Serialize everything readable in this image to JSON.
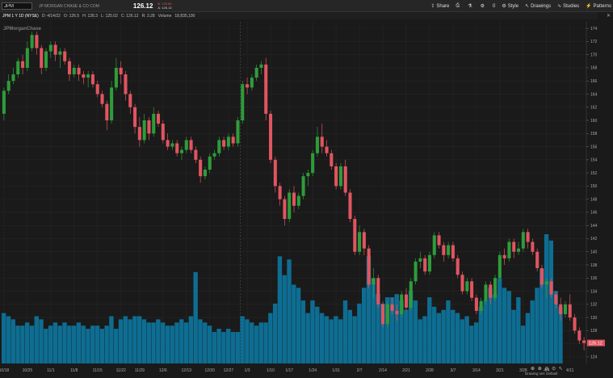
{
  "toolbar": {
    "symbol": "JPM",
    "company": "JP MORGAN CHASE & CO COM",
    "price": "126.12",
    "bid": "B: 125.80",
    "ask": "A: 126.13",
    "share": "Share",
    "count": "0",
    "style": "Style",
    "drawings": "Drawings",
    "studies": "Studies",
    "patterns": "Patterns"
  },
  "info": {
    "series": "JPM 1 Y 1D (NYSE)",
    "date": "D: 4/14/22",
    "open": "O: 126.5",
    "high": "H: 128.3",
    "low": "L: 125.02",
    "close": "C: 126.12",
    "change": "R: 3.28",
    "volume_label": "Volume",
    "volume_value": "18,835,190"
  },
  "watermark": "JPMorganChase",
  "footer": "Drawing set: Default",
  "colors": {
    "up": "#2e9c3a",
    "down": "#e05560",
    "volume": "#0e6d92",
    "background": "#1a1a1a",
    "last_price_tag": "#e05560"
  },
  "chart_data": {
    "type": "candlestick",
    "x_tick_labels": [
      "10/18",
      "10/25",
      "11/1",
      "11/8",
      "11/15",
      "11/22",
      "11/29",
      "12/6",
      "12/13",
      "12/20",
      "12/27",
      "1/3",
      "1/10",
      "1/17",
      "1/24",
      "1/31",
      "2/7",
      "2/14",
      "2/21",
      "2/28",
      "3/7",
      "3/14",
      "3/21",
      "3/28",
      "4/4",
      "4/11"
    ],
    "x_tick_index": [
      0,
      5,
      10,
      15,
      20,
      25,
      29,
      34,
      39,
      44,
      48,
      52,
      57,
      61,
      66,
      71,
      76,
      81,
      86,
      91,
      96,
      101,
      106,
      111,
      116,
      121
    ],
    "y_ticks": [
      124,
      126,
      128,
      130,
      132,
      134,
      136,
      138,
      140,
      142,
      144,
      146,
      148,
      150,
      152,
      154,
      156,
      158,
      160,
      162,
      164,
      166,
      168,
      170,
      172,
      174
    ],
    "ylim": [
      123,
      175
    ],
    "last_price": "126.12",
    "candles": [
      [
        161,
        165,
        160,
        164.5
      ],
      [
        164.5,
        167,
        164,
        166
      ],
      [
        166,
        168,
        165.5,
        167
      ],
      [
        167,
        169.5,
        166.5,
        169
      ],
      [
        169,
        170,
        167,
        168
      ],
      [
        168,
        172,
        167.5,
        171
      ],
      [
        171,
        173.5,
        170.5,
        173
      ],
      [
        173,
        173.5,
        170,
        171
      ],
      [
        171,
        171.5,
        167,
        168
      ],
      [
        168,
        171,
        167.5,
        170.5
      ],
      [
        170.5,
        172,
        169.5,
        171.5
      ],
      [
        171.5,
        172,
        169,
        170
      ],
      [
        170,
        171,
        168,
        170.5
      ],
      [
        170.5,
        171,
        168.5,
        169
      ],
      [
        169,
        169.5,
        166,
        167
      ],
      [
        167,
        168.5,
        166.5,
        168
      ],
      [
        168,
        168.5,
        166,
        167
      ],
      [
        167,
        167.5,
        165.5,
        166.5
      ],
      [
        166.5,
        167.5,
        165,
        167
      ],
      [
        167,
        167.5,
        165,
        165.5
      ],
      [
        165.5,
        166,
        163.5,
        164
      ],
      [
        164,
        164.5,
        162,
        162.5
      ],
      [
        162.5,
        163,
        158.5,
        160
      ],
      [
        160,
        166,
        159.5,
        165
      ],
      [
        165,
        169.5,
        164.5,
        168
      ],
      [
        168,
        169,
        165.5,
        167
      ],
      [
        167,
        167.5,
        163,
        164
      ],
      [
        164,
        164.5,
        161,
        162
      ],
      [
        162,
        162.5,
        158,
        159
      ],
      [
        159,
        160.5,
        156,
        157
      ],
      [
        157,
        161,
        156.5,
        160
      ],
      [
        160,
        160.5,
        157,
        158
      ],
      [
        158,
        162,
        157.5,
        161
      ],
      [
        161,
        161.5,
        159,
        159.5
      ],
      [
        159.5,
        160,
        156.5,
        157
      ],
      [
        157,
        158,
        155.5,
        156
      ],
      [
        156,
        157,
        155.5,
        156.5
      ],
      [
        156.5,
        157,
        154.5,
        155
      ],
      [
        155,
        156,
        154,
        155.5
      ],
      [
        155.5,
        157.5,
        155,
        157
      ],
      [
        157,
        157.5,
        155,
        155.5
      ],
      [
        155.5,
        156,
        153.5,
        154
      ],
      [
        154,
        154.5,
        150.5,
        151.5
      ],
      [
        151.5,
        153,
        151,
        152.5
      ],
      [
        152.5,
        155,
        152,
        154.5
      ],
      [
        154.5,
        155.5,
        154,
        155
      ],
      [
        155,
        157.5,
        154.5,
        157
      ],
      [
        157,
        157.5,
        155.5,
        156
      ],
      [
        156,
        158,
        155.5,
        157.5
      ],
      [
        157.5,
        158,
        156,
        156.5
      ],
      [
        156.5,
        160.5,
        156,
        160
      ],
      [
        160,
        166,
        159.5,
        165.5
      ],
      [
        165.5,
        166.5,
        164,
        165
      ],
      [
        165,
        167,
        164.5,
        166.5
      ],
      [
        166.5,
        168.5,
        166,
        168
      ],
      [
        168,
        169,
        167,
        168.5
      ],
      [
        168.5,
        169.5,
        160,
        161
      ],
      [
        161,
        161.5,
        153.5,
        154
      ],
      [
        154,
        154.5,
        149,
        150
      ],
      [
        150,
        150.5,
        147,
        148
      ],
      [
        148,
        148.5,
        144,
        145
      ],
      [
        145,
        149.5,
        144.5,
        149
      ],
      [
        149,
        150,
        146,
        147
      ],
      [
        147,
        149,
        146.5,
        148.5
      ],
      [
        148.5,
        152,
        148,
        151.5
      ],
      [
        151.5,
        152.5,
        150,
        152
      ],
      [
        152,
        155.5,
        151.5,
        155
      ],
      [
        155,
        159,
        154.5,
        157.5
      ],
      [
        157.5,
        159.5,
        155,
        156
      ],
      [
        156,
        157,
        154.5,
        155
      ],
      [
        155,
        155.5,
        152.5,
        153
      ],
      [
        153,
        153.5,
        149.5,
        150
      ],
      [
        150,
        153.5,
        149.5,
        153
      ],
      [
        153,
        154,
        148.5,
        149
      ],
      [
        149,
        149.5,
        144.5,
        145
      ],
      [
        145,
        145.5,
        139.5,
        140
      ],
      [
        140,
        144,
        139.5,
        143
      ],
      [
        143,
        143.5,
        139.5,
        140.5
      ],
      [
        140.5,
        141,
        134.5,
        135
      ],
      [
        135,
        137.5,
        133,
        136
      ],
      [
        136,
        136.5,
        131.5,
        132
      ],
      [
        132,
        132.5,
        128.5,
        129
      ],
      [
        129,
        132.5,
        128.5,
        132
      ],
      [
        132,
        133,
        130.5,
        131
      ],
      [
        131,
        132,
        129.5,
        130.5
      ],
      [
        130.5,
        134,
        130,
        133.5
      ],
      [
        133.5,
        134.5,
        131,
        131.5
      ],
      [
        131.5,
        136,
        131,
        135.5
      ],
      [
        135.5,
        139,
        135,
        138.5
      ],
      [
        138.5,
        140,
        137.5,
        139
      ],
      [
        139,
        139.5,
        136.5,
        137
      ],
      [
        137,
        140,
        136.5,
        139.5
      ],
      [
        139.5,
        143,
        139,
        142.5
      ],
      [
        142.5,
        143,
        140.5,
        141
      ],
      [
        141,
        141.5,
        138.5,
        139.5
      ],
      [
        139.5,
        141.5,
        139,
        141
      ],
      [
        141,
        141.5,
        138.5,
        139
      ],
      [
        139,
        139.5,
        136,
        136.5
      ],
      [
        136.5,
        137,
        133.5,
        134
      ],
      [
        134,
        136,
        133.5,
        135.5
      ],
      [
        135.5,
        136,
        132.5,
        133
      ],
      [
        133,
        133.5,
        130.5,
        131
      ],
      [
        131,
        133,
        130.5,
        132.5
      ],
      [
        132.5,
        135.5,
        132,
        135
      ],
      [
        135,
        135.5,
        132,
        133
      ],
      [
        133,
        136.5,
        132.5,
        136
      ],
      [
        136,
        140,
        135.5,
        139.5
      ],
      [
        139.5,
        140.5,
        138,
        139
      ],
      [
        139,
        142,
        138.5,
        141.5
      ],
      [
        141.5,
        142,
        139,
        140
      ],
      [
        140,
        141.5,
        139.5,
        140.5
      ],
      [
        140.5,
        143.5,
        140,
        143
      ],
      [
        143,
        143.5,
        140.5,
        141.5
      ],
      [
        141.5,
        142,
        139.5,
        140
      ],
      [
        140,
        140.5,
        137,
        137.5
      ],
      [
        137.5,
        138,
        134.5,
        135
      ],
      [
        135,
        136,
        133,
        135.5
      ],
      [
        135.5,
        136,
        133,
        133.5
      ],
      [
        133.5,
        134,
        131.5,
        132
      ],
      [
        132,
        133,
        129.5,
        130.5
      ],
      [
        130.5,
        132.5,
        130,
        132
      ],
      [
        132,
        133.5,
        129.5,
        130
      ],
      [
        130,
        130.5,
        127.5,
        128
      ],
      [
        128,
        128.5,
        126,
        126.5
      ],
      [
        126.5,
        127,
        125,
        126.12
      ]
    ],
    "volume": [
      16,
      15,
      14,
      12,
      12,
      13,
      12,
      15,
      14,
      11,
      12,
      13,
      12,
      13,
      12,
      12,
      13,
      12,
      11,
      12,
      12,
      11,
      12,
      15,
      11,
      14,
      15,
      14,
      15,
      15,
      14,
      13,
      13,
      14,
      13,
      12,
      12,
      13,
      14,
      13,
      15,
      29,
      14,
      13,
      12,
      10,
      11,
      10,
      11,
      10,
      10,
      15,
      14,
      13,
      12,
      13,
      13,
      16,
      19,
      34,
      28,
      33,
      25,
      24,
      20,
      16,
      20,
      18,
      16,
      15,
      14,
      15,
      14,
      20,
      17,
      15,
      19,
      24,
      34,
      27,
      22,
      19,
      21,
      21,
      22,
      20,
      17,
      23,
      20,
      14,
      15,
      21,
      18,
      16,
      17,
      20,
      17,
      16,
      14,
      15,
      12,
      13,
      18,
      20,
      24,
      22,
      27,
      24,
      23,
      17,
      21,
      12,
      16,
      20,
      24,
      30,
      41,
      39,
      23,
      18
    ]
  }
}
